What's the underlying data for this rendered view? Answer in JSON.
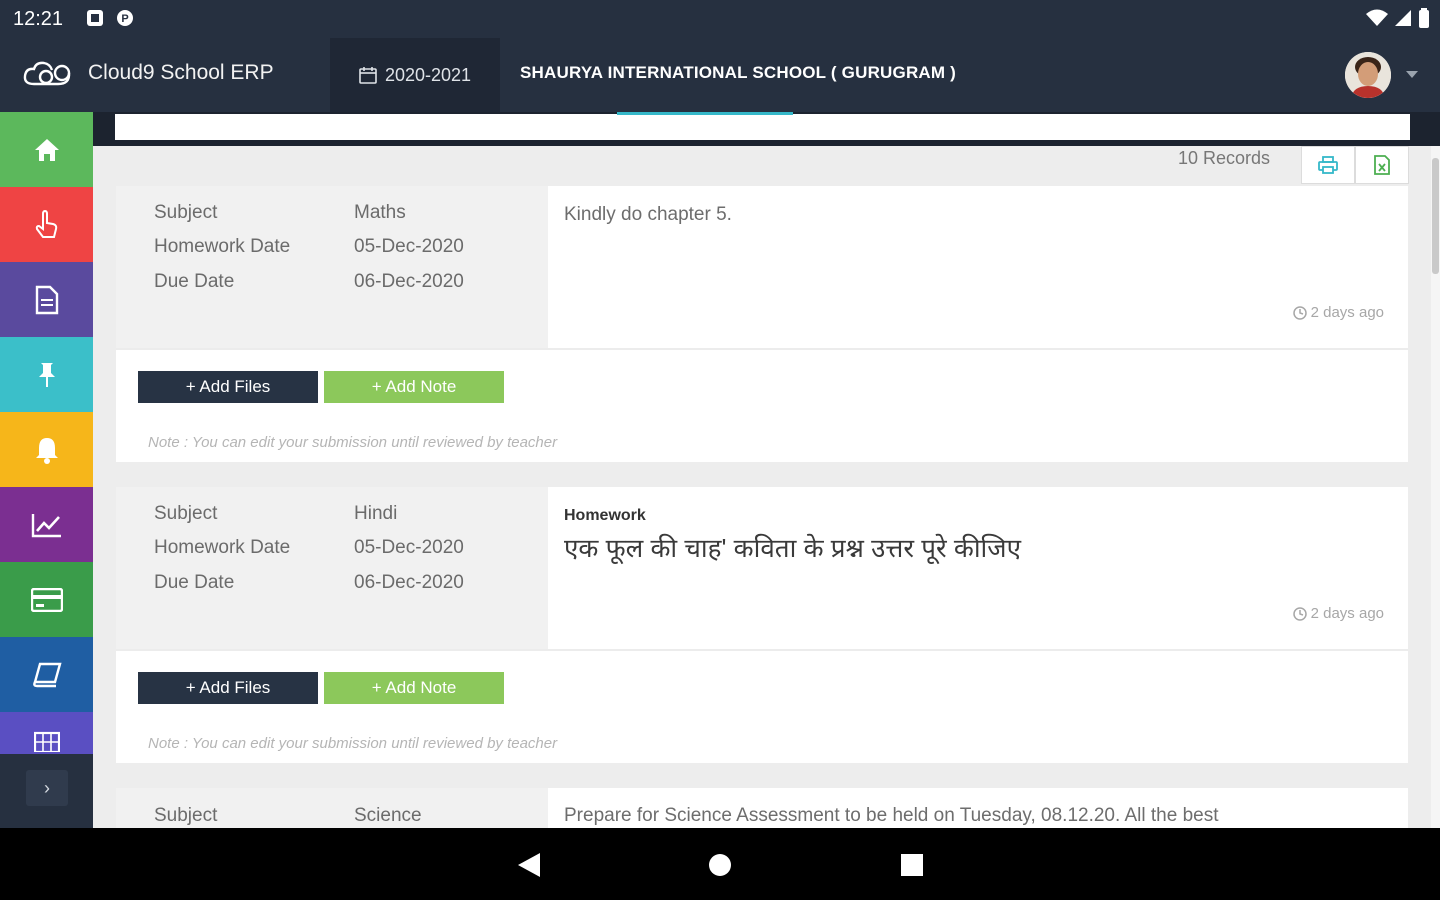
{
  "status_bar": {
    "time": "12:21"
  },
  "header": {
    "app_name": "Cloud9 School ERP",
    "academic_year": "2020-2021",
    "school_name": "SHAURYA INTERNATIONAL SCHOOL ( GURUGRAM )"
  },
  "sidebar": {
    "items": [
      {
        "icon": "home-icon",
        "color": "#5cb85c"
      },
      {
        "icon": "hand-pointer-icon",
        "color": "#ef4444"
      },
      {
        "icon": "document-icon",
        "color": "#5a4a9e"
      },
      {
        "icon": "pin-icon",
        "color": "#3bbfc9"
      },
      {
        "icon": "bell-icon",
        "color": "#f6b61a"
      },
      {
        "icon": "chart-line-icon",
        "color": "#7b2f91"
      },
      {
        "icon": "credit-card-icon",
        "color": "#3a9c4a"
      },
      {
        "icon": "book-icon",
        "color": "#1f5ea3"
      },
      {
        "icon": "calendar-grid-icon",
        "color": "#5a4fc2"
      }
    ],
    "toggle": "›"
  },
  "toolbar": {
    "records": "10 Records"
  },
  "labels": {
    "subject": "Subject",
    "homework_date": "Homework Date",
    "due_date": "Due Date",
    "add_files": "+ Add Files",
    "add_note": "+ Add Note",
    "note": "Note : You can edit your submission until reviewed by teacher"
  },
  "homework": [
    {
      "subject": "Maths",
      "homework_date": "05-Dec-2020",
      "due_date": "06-Dec-2020",
      "description": "Kindly do chapter 5.",
      "posted": "2 days ago"
    },
    {
      "subject": "Hindi",
      "homework_date": "05-Dec-2020",
      "due_date": "06-Dec-2020",
      "heading": "Homework",
      "description": "एक फूल की चाह' कविता के प्रश्न उत्तर पूरे कीजिए",
      "posted": "2 days ago"
    },
    {
      "subject": "Science",
      "description": "Prepare for Science Assessment to be held on Tuesday, 08.12.20. All the best"
    }
  ]
}
